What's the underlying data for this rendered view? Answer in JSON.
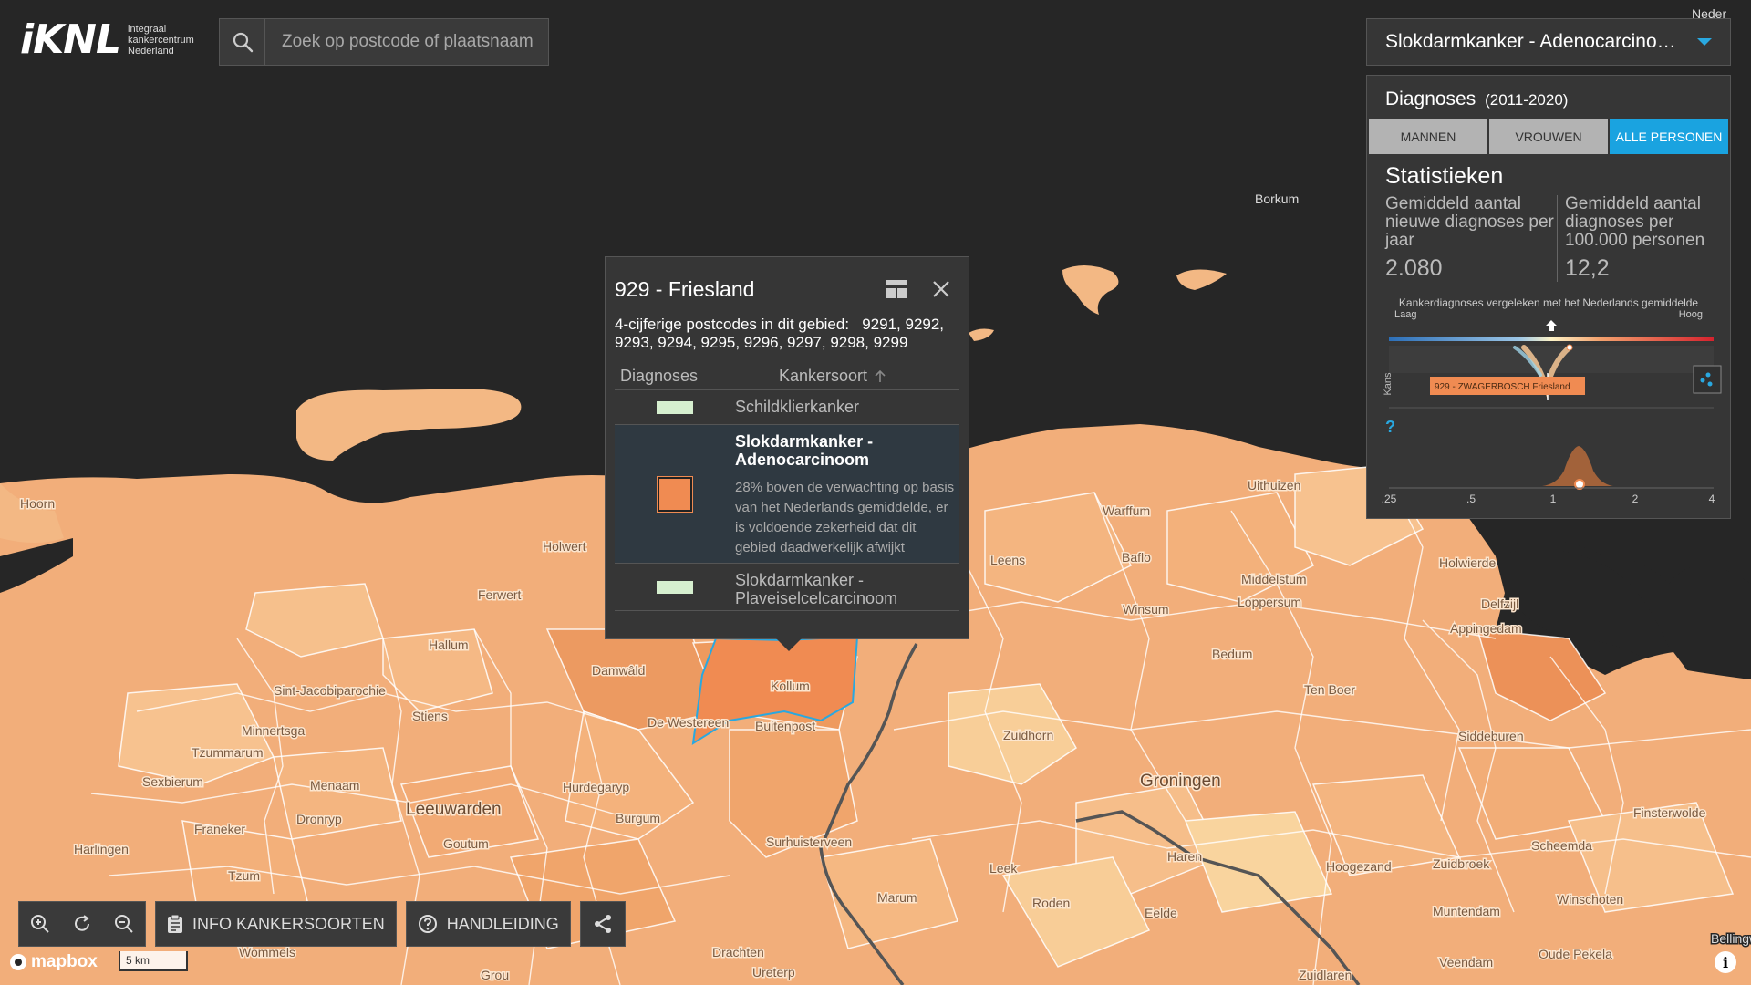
{
  "logo": {
    "mark": "iKNL",
    "line1": "integraal",
    "line2": "kankercentrum",
    "line3": "Nederland"
  },
  "search": {
    "placeholder": "Zoek op postcode of plaatsnaam"
  },
  "selector": {
    "value": "Slokdarmkanker - Adenocarcinoom",
    "accent": "#29a8e0"
  },
  "panel": {
    "title": "Diagnoses",
    "years": "(2011-2020)",
    "tabs": [
      {
        "label": "MANNEN"
      },
      {
        "label": "VROUWEN"
      },
      {
        "label": "ALLE PERSONEN"
      }
    ],
    "stats_title": "Statistieken",
    "stats": [
      {
        "label": "Gemiddeld aantal nieuwe diagnoses per jaar",
        "value": "2.080"
      },
      {
        "label": "Gemiddeld aantal diagnoses per 100.000 personen",
        "value": "12,2"
      }
    ],
    "compare_title": "Kankerdiagnoses vergeleken met het Nederlands gemiddelde",
    "low": "Laag",
    "high": "Hoog",
    "y_label": "Kans",
    "area_label": "929 - ZWAGERBOSCH Friesland",
    "help": "?",
    "axis_ticks": [
      ".25",
      ".5",
      "1",
      "2",
      "4"
    ]
  },
  "popup": {
    "title": "929 - Friesland",
    "codes_label": "4-cijferige postcodes in dit gebied:",
    "codes": "9291, 9292, 9293, 9294, 9295, 9296, 9297, 9298, 9299",
    "col1": "Diagnoses",
    "col2": "Kankersoort",
    "rows": [
      {
        "name": "Schildklierkanker"
      },
      {
        "name": "Slokdarmkanker - Adenocarcinoom",
        "desc": "28% boven de verwachting op basis van het Nederlands gemiddelde, er is voldoende zekerheid dat dit gebied daadwerkelijk afwijkt"
      },
      {
        "name": "Slokdarmkanker - Plaveiselcelcarcinoom"
      }
    ]
  },
  "toolbar": {
    "info": "INFO KANKERSOORTEN",
    "manual": "HANDLEIDING"
  },
  "attribution": {
    "mapbox": "mapbox",
    "scale": "5 km",
    "info": "i"
  },
  "places": [
    "Borkum",
    "Hoorn",
    "Holwert",
    "Ferwert",
    "Hallum",
    "Sint-Jacobiparochie",
    "Minnertsga",
    "Stiens",
    "Tzummarum",
    "Sexbierum",
    "Menaam",
    "Dronryp",
    "Franeker",
    "Harlingen",
    "Tzum",
    "Wommels",
    "Leeuwarden",
    "Goutum",
    "Hurdegaryp",
    "Burgum",
    "Damwâld",
    "De Westereen",
    "Kollum",
    "Buitenpost",
    "Surhuisterveen",
    "Marum",
    "Drachten",
    "Ureterp",
    "Grou",
    "Leens",
    "Warffum",
    "Uithuizen",
    "Baflo",
    "Middelstum",
    "Winsum",
    "Loppersum",
    "Holwierde",
    "Delfzijl",
    "Appingedam",
    "Bedum",
    "Ten Boer",
    "Zuidhorn",
    "Groningen",
    "Siddeburen",
    "Finsterwolde",
    "Scheemda",
    "Haren",
    "Hoogezand",
    "Zuidbroek",
    "Muntendam",
    "Winschoten",
    "Leek",
    "Roden",
    "Eelde",
    "Veendam",
    "Oude Pekela",
    "Zuidlaren",
    "Bellingw",
    "Neder"
  ]
}
